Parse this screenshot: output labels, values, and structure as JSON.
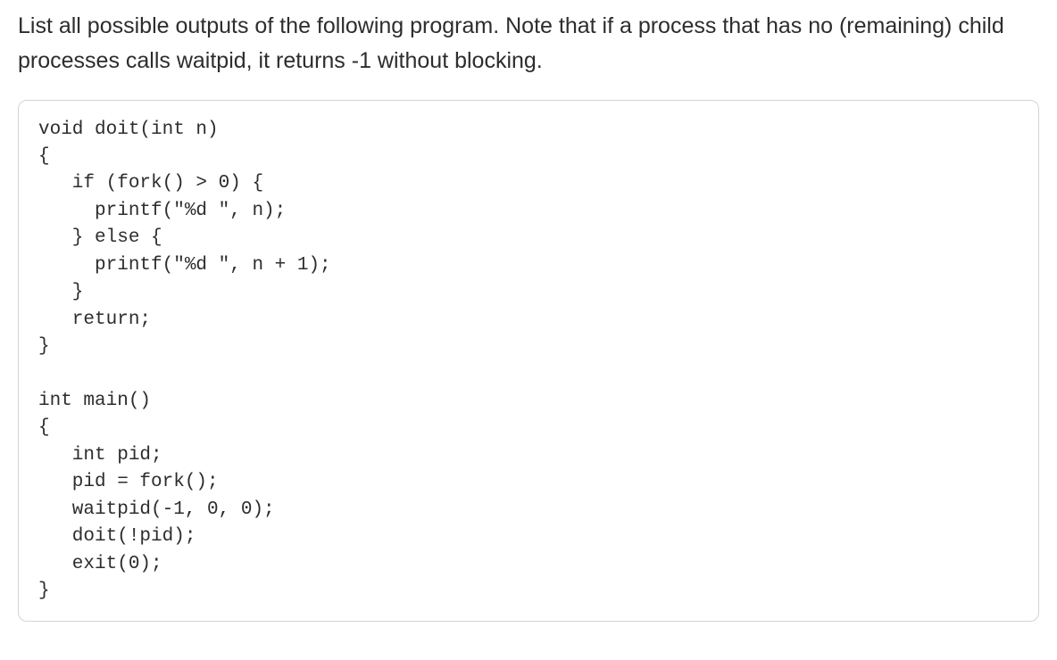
{
  "question": "List all possible outputs of the following program. Note that if a process that has no (remaining) child processes calls waitpid, it returns -1 without blocking.",
  "code": "void doit(int n)\n{\n   if (fork() > 0) {\n     printf(\"%d \", n);\n   } else {\n     printf(\"%d \", n + 1);\n   }\n   return;\n}\n\nint main()\n{\n   int pid;\n   pid = fork();\n   waitpid(-1, 0, 0);\n   doit(!pid);\n   exit(0);\n}"
}
